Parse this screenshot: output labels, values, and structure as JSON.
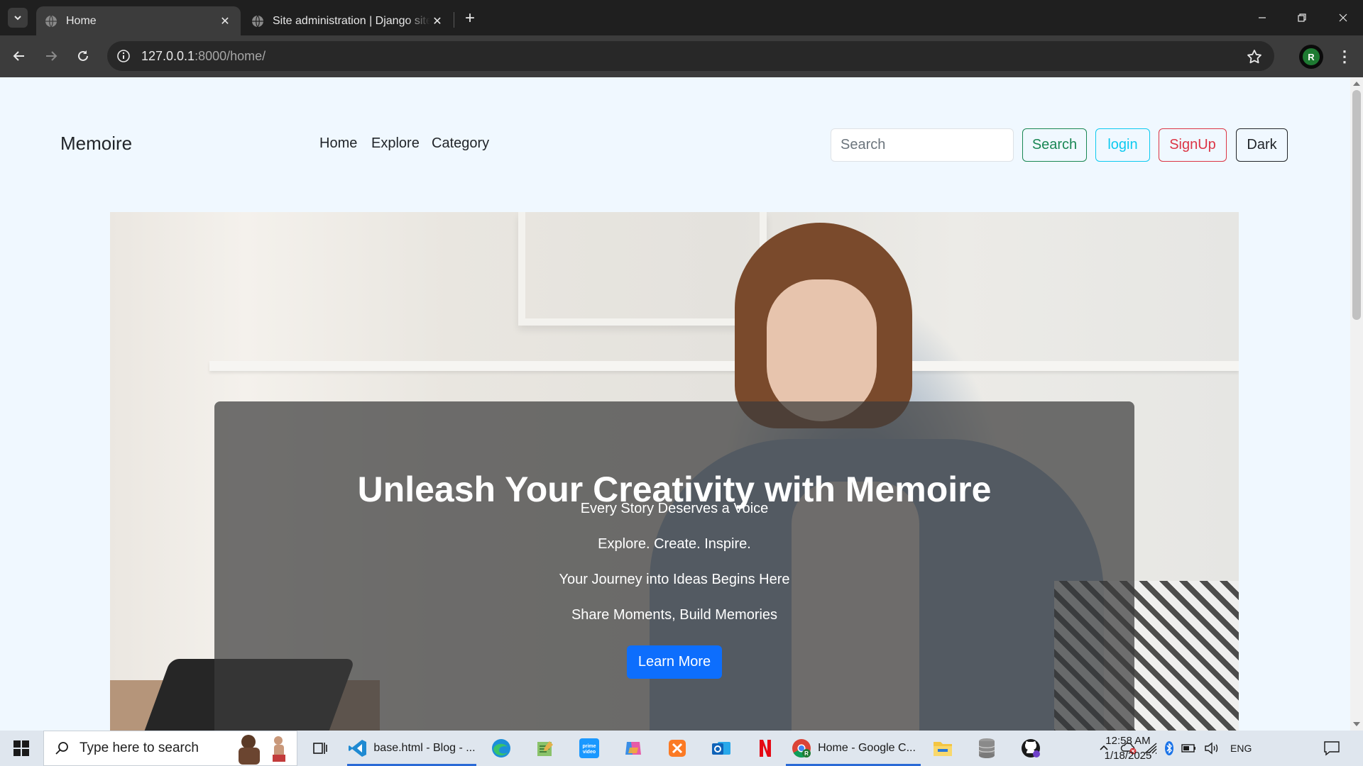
{
  "browser": {
    "tabs": [
      {
        "title": "Home",
        "active": true
      },
      {
        "title": "Site administration | Django site admin",
        "active": false
      }
    ],
    "url_host": "127.0.0.1",
    "url_path": ":8000/home/",
    "profile_initial": "R"
  },
  "site": {
    "brand": "Memoire",
    "nav": {
      "home": "Home",
      "explore": "Explore",
      "category": "Category"
    },
    "search": {
      "placeholder": "Search",
      "value": ""
    },
    "buttons": {
      "search": "Search",
      "login": "login",
      "signup": "SignUp",
      "theme": "Dark"
    }
  },
  "hero": {
    "title": "Unleash Your Creativity with Memoire",
    "lines": [
      "Every Story Deserves a Voice",
      "Explore. Create. Inspire.",
      "Your Journey into Ideas Begins Here",
      "Share Moments, Build Memories"
    ],
    "cta": "Learn More"
  },
  "taskbar": {
    "search_placeholder": "Type here to search",
    "apps": [
      {
        "name": "vscode",
        "label": "base.html - Blog - ..."
      },
      {
        "name": "chrome",
        "label": "Home - Google C..."
      }
    ],
    "language": "ENG",
    "time": "12:58 AM",
    "date": "1/18/2025"
  },
  "colors": {
    "page_bg": "#f0f8ff",
    "success": "#198754",
    "info": "#0dcaf0",
    "danger": "#dc3545",
    "primary": "#0d6efd"
  }
}
